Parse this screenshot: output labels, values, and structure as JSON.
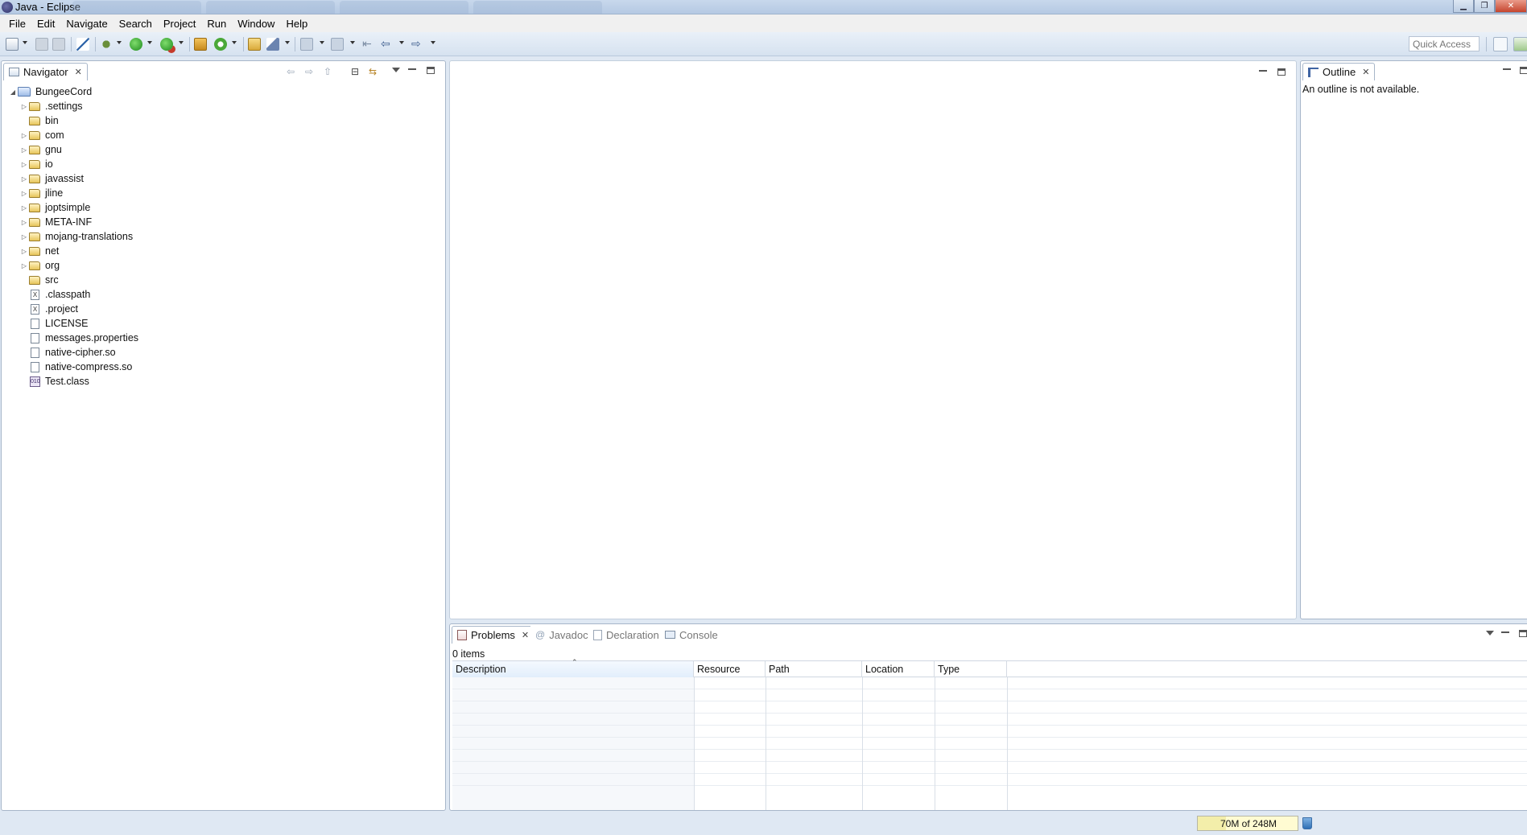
{
  "window": {
    "title": "Java - Eclipse",
    "controls": [
      "minimize",
      "restore",
      "close"
    ]
  },
  "menu": [
    "File",
    "Edit",
    "Navigate",
    "Search",
    "Project",
    "Run",
    "Window",
    "Help"
  ],
  "toolbar": {
    "quick_access_placeholder": "Quick Access"
  },
  "navigator": {
    "tab_label": "Navigator",
    "project": "BungeeCord",
    "items": [
      {
        "label": ".settings",
        "kind": "folder",
        "expandable": true
      },
      {
        "label": "bin",
        "kind": "folder",
        "expandable": false
      },
      {
        "label": "com",
        "kind": "folder",
        "expandable": true
      },
      {
        "label": "gnu",
        "kind": "folder",
        "expandable": true
      },
      {
        "label": "io",
        "kind": "folder",
        "expandable": true
      },
      {
        "label": "javassist",
        "kind": "folder",
        "expandable": true
      },
      {
        "label": "jline",
        "kind": "folder",
        "expandable": true
      },
      {
        "label": "joptsimple",
        "kind": "folder",
        "expandable": true
      },
      {
        "label": "META-INF",
        "kind": "folder",
        "expandable": true
      },
      {
        "label": "mojang-translations",
        "kind": "folder",
        "expandable": true
      },
      {
        "label": "net",
        "kind": "folder",
        "expandable": true
      },
      {
        "label": "org",
        "kind": "folder",
        "expandable": true
      },
      {
        "label": "src",
        "kind": "folder",
        "expandable": false
      },
      {
        "label": ".classpath",
        "kind": "xml-file",
        "expandable": false
      },
      {
        "label": ".project",
        "kind": "xml-file",
        "expandable": false
      },
      {
        "label": "LICENSE",
        "kind": "file",
        "expandable": false
      },
      {
        "label": "messages.properties",
        "kind": "file",
        "expandable": false
      },
      {
        "label": "native-cipher.so",
        "kind": "file",
        "expandable": false
      },
      {
        "label": "native-compress.so",
        "kind": "file",
        "expandable": false
      },
      {
        "label": "Test.class",
        "kind": "class-file",
        "expandable": false
      }
    ]
  },
  "outline": {
    "tab_label": "Outline",
    "message": "An outline is not available."
  },
  "bottom_panel": {
    "tabs": [
      {
        "label": "Problems",
        "active": true
      },
      {
        "label": "Javadoc",
        "active": false
      },
      {
        "label": "Declaration",
        "active": false
      },
      {
        "label": "Console",
        "active": false
      }
    ],
    "items_count": "0 items",
    "columns": [
      "Description",
      "Resource",
      "Path",
      "Location",
      "Type"
    ]
  },
  "status": {
    "heap": "70M of 248M",
    "heap_fraction": 0.28
  },
  "colors": {
    "chrome_bg": "#dfe8f3",
    "panel_border": "#a7b6c9",
    "heap_bg": "#fffbd2"
  }
}
